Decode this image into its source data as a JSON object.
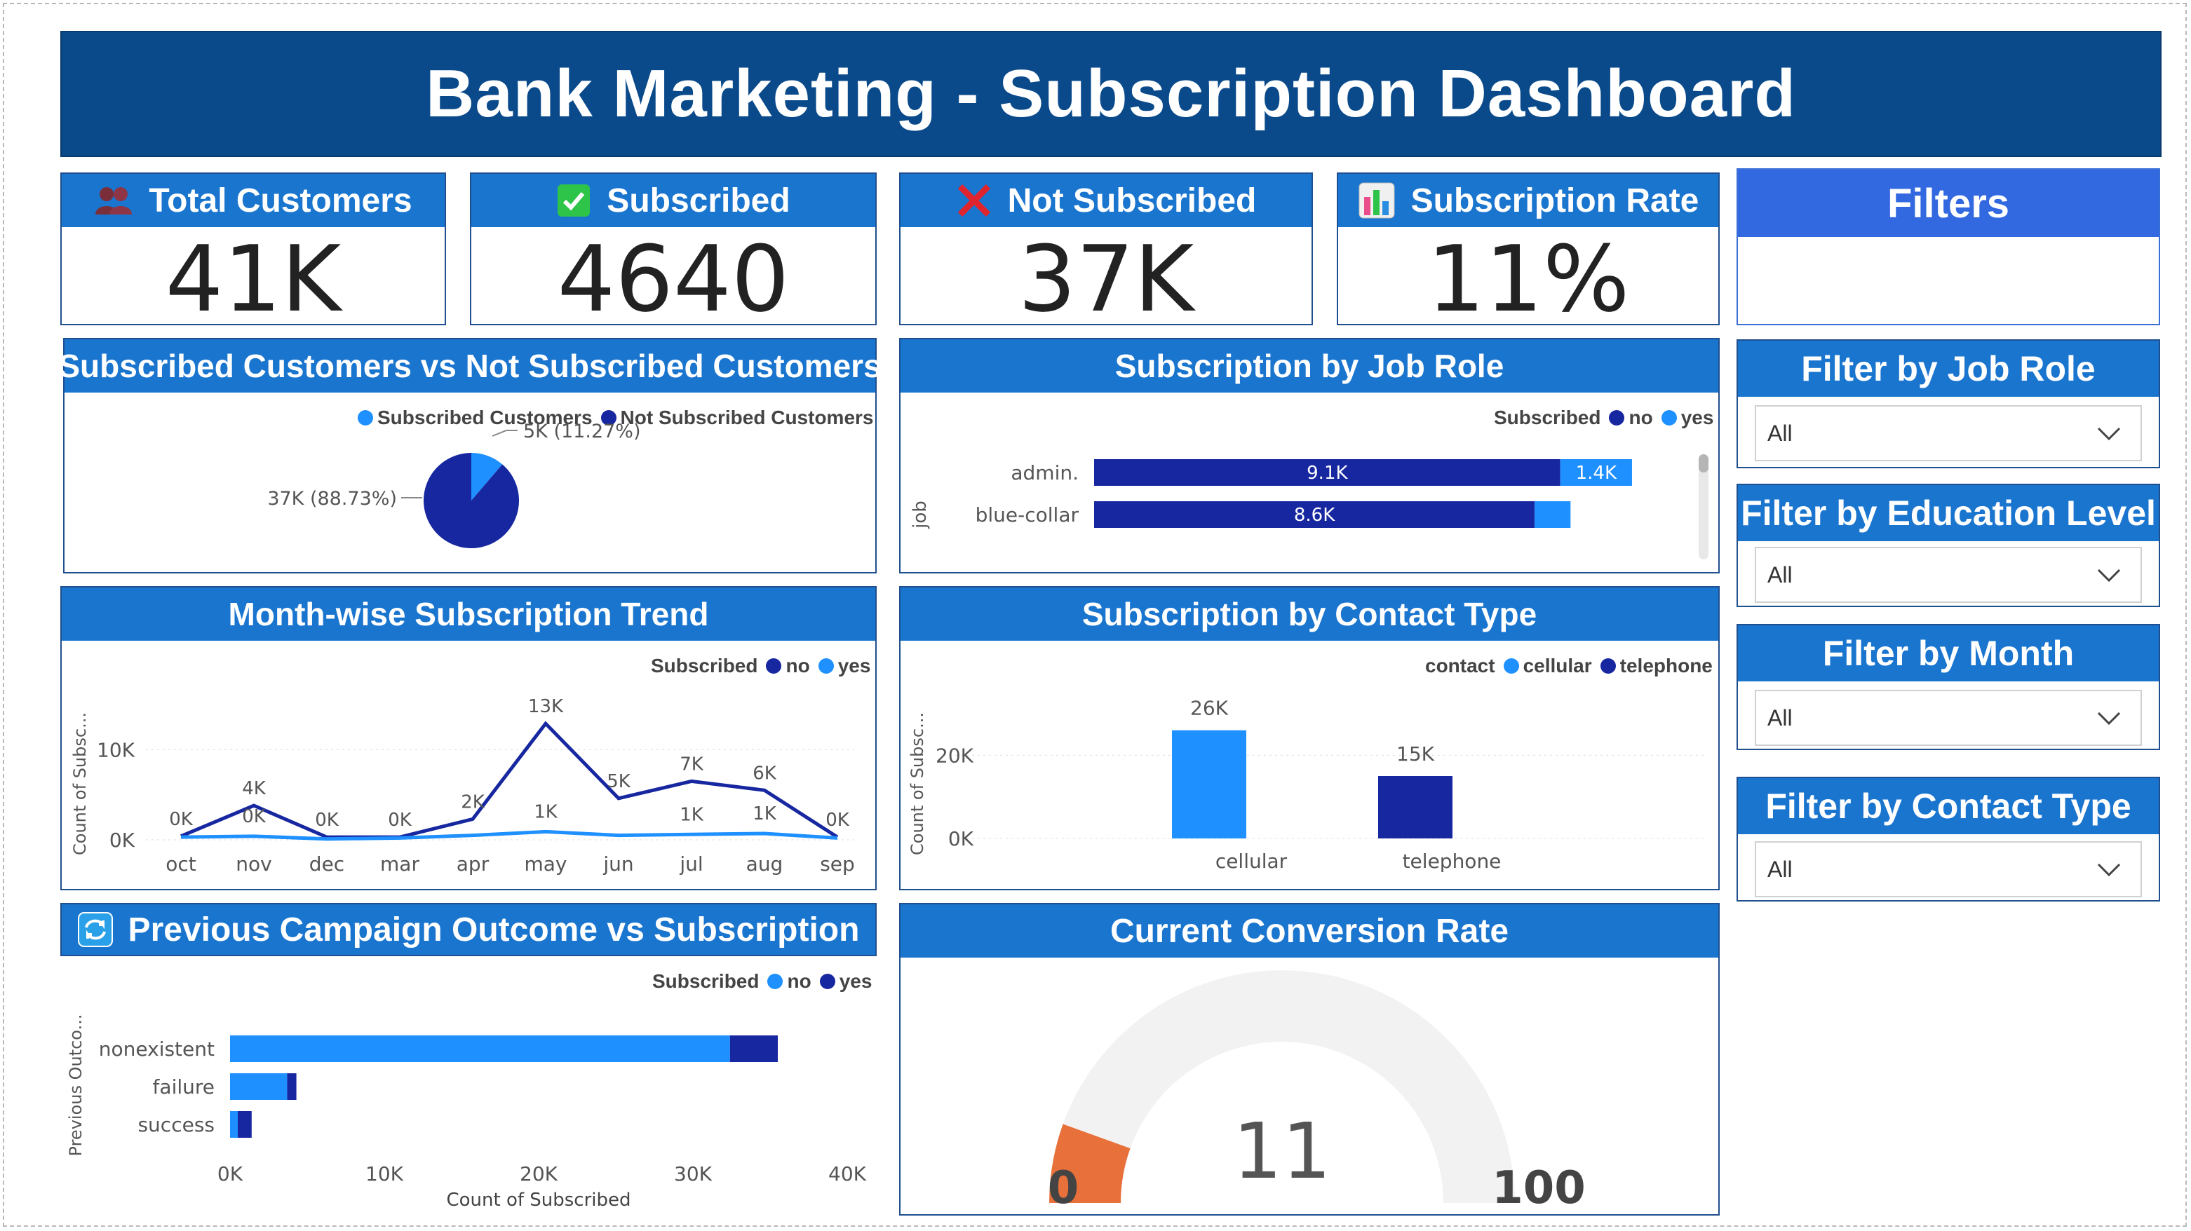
{
  "header": {
    "title": "Bank Marketing - Subscription Dashboard"
  },
  "kpis": {
    "total_customers": {
      "label": "Total Customers",
      "value": "41K"
    },
    "subscribed": {
      "label": "Subscribed",
      "value": "4640"
    },
    "not_subscribed": {
      "label": "Not Subscribed",
      "value": "37K"
    },
    "subscription_rate": {
      "label": "Subscription Rate",
      "value": "11%"
    }
  },
  "filters": {
    "title": "Filters",
    "job_role": {
      "label": "Filter by Job Role",
      "value": "All"
    },
    "education": {
      "label": "Filter by Education Level",
      "value": "All"
    },
    "month": {
      "label": "Filter by Month",
      "value": "All"
    },
    "contact": {
      "label": "Filter by Contact Type",
      "value": "All"
    }
  },
  "colors": {
    "header": "#0a4a8a",
    "panel_head": "#1a75cf",
    "light_blue": "#1e90ff",
    "dark_blue": "#1727a0",
    "gauge_fill": "#e8703a",
    "gauge_bg": "#f2f2f2"
  },
  "chart_data": [
    {
      "id": "pie",
      "type": "pie",
      "title": "Subscribed Customers vs Not Subscribed Customers",
      "legend": [
        "Subscribed Customers",
        "Not Subscribed Customers"
      ],
      "slices": [
        {
          "name": "Subscribed Customers",
          "value": 4640,
          "label": "5K (11.27%)",
          "color": "#1e90ff"
        },
        {
          "name": "Not Subscribed Customers",
          "value": 36548,
          "label": "37K (88.73%)",
          "color": "#1727a0"
        }
      ]
    },
    {
      "id": "job",
      "type": "bar",
      "title": "Subscription by Job Role",
      "legend_title": "Subscribed",
      "legend": [
        "no",
        "yes"
      ],
      "ylabel": "job",
      "categories": [
        "admin.",
        "blue-collar"
      ],
      "series": [
        {
          "name": "no",
          "values": [
            9100,
            8600
          ],
          "labels": [
            "9.1K",
            "8.6K"
          ],
          "color": "#1727a0"
        },
        {
          "name": "yes",
          "values": [
            1400,
            700
          ],
          "labels": [
            "1.4K",
            ""
          ],
          "color": "#1e90ff"
        }
      ],
      "xlim": [
        0,
        11500
      ]
    },
    {
      "id": "trend",
      "type": "line",
      "title": "Month-wise Subscription Trend",
      "legend_title": "Subscribed",
      "legend": [
        "no",
        "yes"
      ],
      "ylabel": "Count of Subsc...",
      "categories": [
        "oct",
        "nov",
        "dec",
        "mar",
        "apr",
        "may",
        "jun",
        "jul",
        "aug",
        "sep"
      ],
      "series": [
        {
          "name": "no",
          "values": [
            400,
            3800,
            300,
            300,
            2300,
            12900,
            4600,
            6500,
            5500,
            300
          ],
          "labels": [
            "0K",
            "4K",
            "0K",
            "0K",
            "2K",
            "13K",
            "5K",
            "7K",
            "6K",
            "0K"
          ],
          "color": "#1727a0"
        },
        {
          "name": "yes",
          "values": [
            300,
            400,
            100,
            200,
            500,
            900,
            500,
            600,
            700,
            200
          ],
          "labels": [
            "",
            "0K",
            "",
            "",
            "",
            "1K",
            "",
            "1K",
            "1K",
            ""
          ],
          "color": "#1e90ff"
        }
      ],
      "yticks": [
        "0K",
        "10K"
      ],
      "ylim": [
        0,
        14000
      ]
    },
    {
      "id": "contact",
      "type": "bar",
      "title": "Subscription by Contact Type",
      "legend_title": "contact",
      "legend": [
        "cellular",
        "telephone"
      ],
      "ylabel": "Count of Subsc...",
      "categories": [
        "cellular",
        "telephone"
      ],
      "values": [
        26000,
        15000
      ],
      "labels": [
        "26K",
        "15K"
      ],
      "colors": [
        "#1e90ff",
        "#1727a0"
      ],
      "yticks": [
        "0K",
        "20K"
      ],
      "ylim": [
        0,
        30000
      ]
    },
    {
      "id": "outcome",
      "type": "bar",
      "title": "Previous Campaign Outcome vs Subscription",
      "legend_title": "Subscribed",
      "legend": [
        "no",
        "yes"
      ],
      "xlabel": "Count of Subscribed",
      "ylabel": "Previous Outco...",
      "categories": [
        "nonexistent",
        "failure",
        "success"
      ],
      "series": [
        {
          "name": "no",
          "values": [
            32400,
            3700,
            500
          ],
          "color": "#1e90ff"
        },
        {
          "name": "yes",
          "values": [
            3100,
            600,
            900
          ],
          "color": "#1727a0"
        }
      ],
      "xticks": [
        "0K",
        "10K",
        "20K",
        "30K",
        "40K"
      ],
      "xlim": [
        0,
        40000
      ]
    },
    {
      "id": "gauge",
      "type": "gauge",
      "title": "Current Conversion Rate",
      "value": 11,
      "min": 0,
      "max": 100,
      "value_label": "11",
      "min_label": "0",
      "max_label": "100"
    }
  ]
}
